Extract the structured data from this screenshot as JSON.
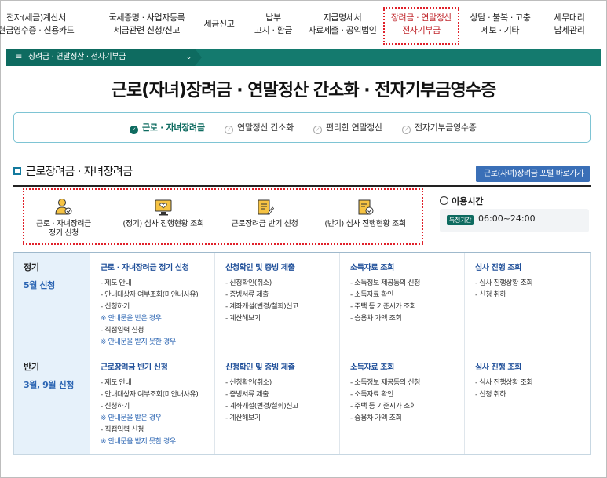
{
  "topnav": {
    "items": [
      {
        "line1": "전자(세금)계산서",
        "line2": "현금영수증 · 신용카드"
      },
      {
        "line1": "국세증명 · 사업자등록",
        "line2": "세금관련 신청/신고"
      },
      {
        "line1": "세금신고",
        "line2": ""
      },
      {
        "line1": "납부",
        "line2": "고지 · 환급"
      },
      {
        "line1": "지급명세서",
        "line2": "자료제출 · 공익법인"
      },
      {
        "line1": "장려금 · 연말정산",
        "line2": "전자기부금"
      },
      {
        "line1": "상담 · 불복 · 고충",
        "line2": "제보 · 기타"
      },
      {
        "line1": "세무대리",
        "line2": "납세관리"
      }
    ]
  },
  "breadcrumb": {
    "label": "장려금 · 연말정산 · 전자기부금"
  },
  "page": {
    "title": "근로(자녀)장려금 · 연말정산 간소화 · 전자기부금영수증"
  },
  "tabs": [
    {
      "label": "근로 · 자녀장려금"
    },
    {
      "label": "연말정산 간소화"
    },
    {
      "label": "편리한 연말정산"
    },
    {
      "label": "전자기부금영수증"
    }
  ],
  "section": {
    "title": "근로장려금 · 자녀장려금",
    "portal_button": "근로(자녀)장려금 포털 바로가기"
  },
  "quick_menu": [
    {
      "line1": "근로 · 자녀장려금",
      "line2": "정기 신청"
    },
    {
      "line1": "(정기) 심사 진행현황 조회",
      "line2": ""
    },
    {
      "line1": "근로장려금 반기 신청",
      "line2": ""
    },
    {
      "line1": "(반기) 심사 진행현황 조회",
      "line2": ""
    }
  ],
  "usage_time": {
    "title": "이용시간",
    "badge": "특정기간",
    "hours": "06:00~24:00"
  },
  "table": {
    "rows": [
      {
        "period": "정기",
        "date": "5월 신청",
        "columns": [
          {
            "head": "근로 · 자녀장려금 정기 신청",
            "items": [
              {
                "text": "- 제도 안내",
                "note": false
              },
              {
                "text": "- 안내대상자 여부조회(미안내사유)",
                "note": false
              },
              {
                "text": "- 신청하기",
                "note": false
              },
              {
                "text": "※ 안내문을 받은 경우",
                "note": true
              },
              {
                "text": "- 직접입력 신청",
                "note": false
              },
              {
                "text": "※ 안내문을 받지 못한 경우",
                "note": true
              }
            ]
          },
          {
            "head": "신청확인 및 증빙 제출",
            "items": [
              {
                "text": "- 신청확인(취소)",
                "note": false
              },
              {
                "text": "- 증빙서류 제출",
                "note": false
              },
              {
                "text": "- 계좌개설(변경/철회)신고",
                "note": false
              },
              {
                "text": "- 계산해보기",
                "note": false
              }
            ]
          },
          {
            "head": "소득자료 조회",
            "items": [
              {
                "text": "- 소득정보 제공동의 신청",
                "note": false
              },
              {
                "text": "- 소득자료 확인",
                "note": false
              },
              {
                "text": "- 주택 등 기준시가 조회",
                "note": false
              },
              {
                "text": "- 승용차 가액 조회",
                "note": false
              }
            ]
          },
          {
            "head": "심사 진행 조회",
            "items": [
              {
                "text": "- 심사 진행상황 조회",
                "note": false
              },
              {
                "text": "- 신청 취하",
                "note": false
              }
            ]
          }
        ]
      },
      {
        "period": "반기",
        "date": "3월, 9월 신청",
        "columns": [
          {
            "head": "근로장려금 반기 신청",
            "items": [
              {
                "text": "- 제도 안내",
                "note": false
              },
              {
                "text": "- 안내대상자 여부조회(미안내사유)",
                "note": false
              },
              {
                "text": "- 신청하기",
                "note": false
              },
              {
                "text": "※ 안내문을 받은 경우",
                "note": true
              },
              {
                "text": "- 직접입력 신청",
                "note": false
              },
              {
                "text": "※ 안내문을 받지 못한 경우",
                "note": true
              }
            ]
          },
          {
            "head": "신청확인 및 증빙 제출",
            "items": [
              {
                "text": "- 신청확인(취소)",
                "note": false
              },
              {
                "text": "- 증빙서류 제출",
                "note": false
              },
              {
                "text": "- 계좌개설(변경/철회)신고",
                "note": false
              },
              {
                "text": "- 계산해보기",
                "note": false
              }
            ]
          },
          {
            "head": "소득자료 조회",
            "items": [
              {
                "text": "- 소득정보 제공동의 신청",
                "note": false
              },
              {
                "text": "- 소득자료 확인",
                "note": false
              },
              {
                "text": "- 주택 등 기준시가 조회",
                "note": false
              },
              {
                "text": "- 승용차 가액 조회",
                "note": false
              }
            ]
          },
          {
            "head": "심사 진행 조회",
            "items": [
              {
                "text": "- 심사 진행상황 조회",
                "note": false
              },
              {
                "text": "- 신청 취하",
                "note": false
              }
            ]
          }
        ]
      }
    ]
  },
  "colors": {
    "brand_green": "#0e6b60",
    "link_blue": "#2a64b2",
    "highlight_red": "#e0202a",
    "portal_button": "#3a6fb7"
  }
}
